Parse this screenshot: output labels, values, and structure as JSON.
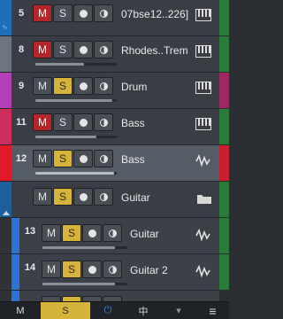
{
  "tracks": [
    {
      "num": "5",
      "name": "07bse12..226]",
      "mute_active": true,
      "solo_active": false,
      "color": "#1f6fb8",
      "icon": "piano-keys-icon",
      "vol": 0.0
    },
    {
      "num": "8",
      "name": "Rhodes..Trem",
      "mute_active": true,
      "solo_active": false,
      "color": "#6c7580",
      "icon": "piano-keys-icon",
      "vol": 0.6
    },
    {
      "num": "9",
      "name": "Drum",
      "mute_active": false,
      "solo_active": true,
      "color": "#b340b8",
      "icon": "piano-keys-icon",
      "vol": 0.95
    },
    {
      "num": "11",
      "name": "Bass",
      "mute_active": true,
      "solo_active": false,
      "color": "#cc2f5e",
      "icon": "piano-keys-icon",
      "vol": 0.75
    },
    {
      "num": "12",
      "name": "Bass",
      "mute_active": false,
      "solo_active": true,
      "color": "#e01a2a",
      "icon": "waveform-icon",
      "vol": 0.97
    }
  ],
  "folder_track": {
    "name": "Guitar",
    "mute_active": false,
    "solo_active": true,
    "color": "#1d5f9a",
    "icon": "folder-icon"
  },
  "child_tracks": [
    {
      "num": "13",
      "name": "Guitar",
      "mute_active": false,
      "solo_active": true,
      "color": "#2a74d6",
      "icon": "waveform-icon",
      "vol": 0.85
    },
    {
      "num": "14",
      "name": "Guitar 2",
      "mute_active": false,
      "solo_active": true,
      "color": "#2a74d6",
      "icon": "waveform-icon",
      "vol": 0.85
    }
  ],
  "labels": {
    "mute": "M",
    "solo": "S"
  },
  "footer": {
    "mute": "M",
    "solo": "S",
    "power": "⏻",
    "center": "中",
    "arrow": "▾",
    "menu": "≡"
  }
}
